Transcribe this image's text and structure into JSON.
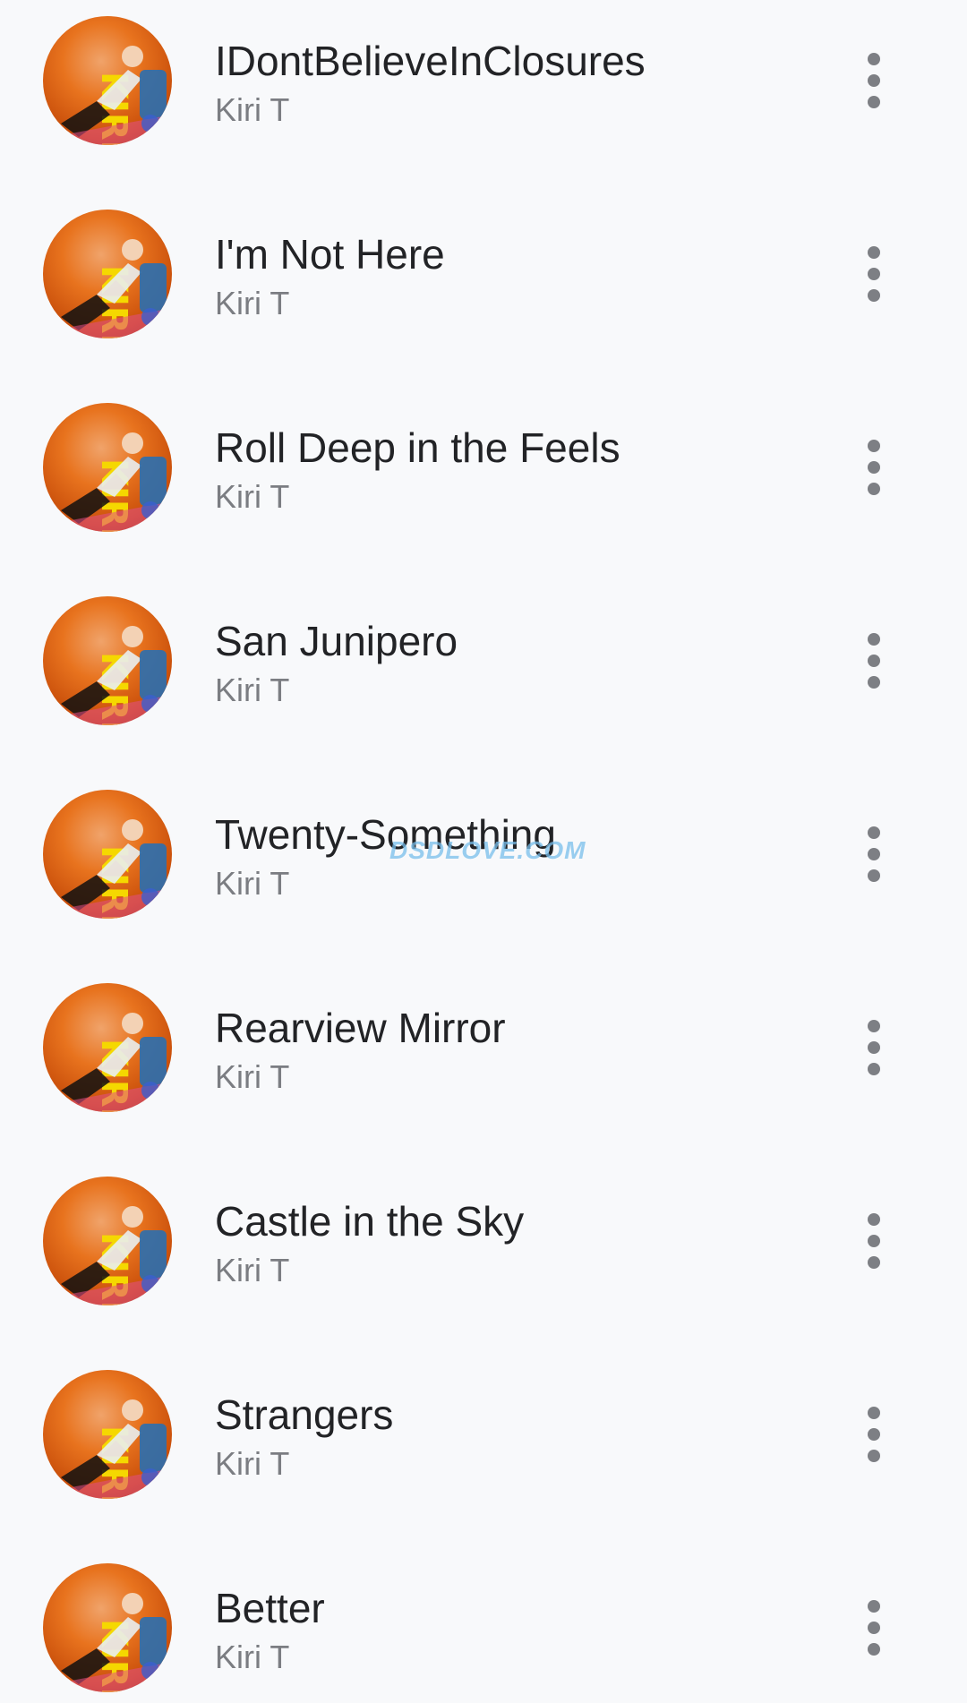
{
  "songs": [
    {
      "title": "IDontBelieveInClosures",
      "artist": "Kiri T",
      "art_icon": "album-art-kiri"
    },
    {
      "title": "I'm Not Here",
      "artist": "Kiri T",
      "art_icon": "album-art-kiri"
    },
    {
      "title": "Roll Deep in the Feels",
      "artist": "Kiri T",
      "art_icon": "album-art-kiri"
    },
    {
      "title": "San Junipero",
      "artist": "Kiri T",
      "art_icon": "album-art-kiri"
    },
    {
      "title": "Twenty-Something",
      "artist": "Kiri T",
      "art_icon": "album-art-kiri"
    },
    {
      "title": "Rearview Mirror",
      "artist": "Kiri T",
      "art_icon": "album-art-kiri"
    },
    {
      "title": "Castle in the Sky",
      "artist": "Kiri T",
      "art_icon": "album-art-kiri"
    },
    {
      "title": "Strangers",
      "artist": "Kiri T",
      "art_icon": "album-art-kiri"
    },
    {
      "title": "Better",
      "artist": "Kiri T",
      "art_icon": "album-art-kiri"
    }
  ],
  "row_menu_icon": "more-vert-icon",
  "watermark": "DSDLOVE.COM",
  "colors": {
    "background": "#f8f9fb",
    "title": "#222326",
    "artist": "#7b7d82",
    "menu_dots": "#7d7f84",
    "album_orange": "#e8731e",
    "album_yellow": "#f5d800"
  }
}
